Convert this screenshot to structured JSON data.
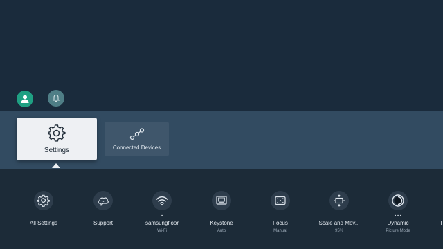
{
  "profile": {
    "avatar_icon": "person-icon",
    "notification_icon": "bell-icon"
  },
  "band": {
    "settings_tile": {
      "label": "Settings",
      "icon": "gear-icon"
    },
    "connected_tile": {
      "label": "Connected Devices",
      "icon": "share-nodes-icon"
    }
  },
  "quick_settings": [
    {
      "label": "All Settings",
      "sub": "",
      "icon": "gear-icon",
      "dots": ""
    },
    {
      "label": "Support",
      "sub": "",
      "icon": "chat-cloud-icon",
      "dots": ""
    },
    {
      "label": "samsungfloor",
      "sub": "Wi-Fi",
      "icon": "wifi-icon",
      "dots": "•"
    },
    {
      "label": "Keystone",
      "sub": "Auto",
      "icon": "keystone-icon",
      "dots": ""
    },
    {
      "label": "Focus",
      "sub": "Manual",
      "icon": "focus-icon",
      "dots": ""
    },
    {
      "label": "Scale and Mov...",
      "sub": "95%",
      "icon": "scale-move-icon",
      "dots": ""
    },
    {
      "label": "Dynamic",
      "sub": "Picture Mode",
      "icon": "picture-mode-icon",
      "dots": "• • •"
    },
    {
      "label": "F",
      "sub": "",
      "icon": "",
      "dots": ""
    }
  ],
  "colors": {
    "accent_avatar": "#1fa083",
    "band": "#324b61",
    "background": "#1a2a3b"
  }
}
